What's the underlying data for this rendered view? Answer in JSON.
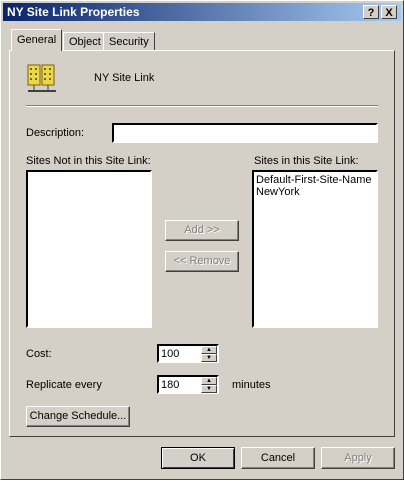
{
  "window": {
    "title": "NY Site Link Properties",
    "help_label": "?",
    "close_label": "X"
  },
  "tabs": [
    {
      "label": "General",
      "active": true
    },
    {
      "label": "Object",
      "active": false
    },
    {
      "label": "Security",
      "active": false
    }
  ],
  "general": {
    "object_name": "NY Site Link",
    "icon": "site-link-icon",
    "description_label": "Description:",
    "description_value": "",
    "sites_not_label": "Sites Not in this Site Link:",
    "sites_in_label": "Sites in this Site Link:",
    "sites_not": [],
    "sites_in": [
      "Default-First-Site-Name",
      "NewYork"
    ],
    "add_label": "Add >>",
    "remove_label": "<< Remove",
    "cost_label": "Cost:",
    "cost_value": "100",
    "replicate_label": "Replicate every",
    "replicate_value": "180",
    "minutes_label": "minutes",
    "change_schedule_label": "Change Schedule..."
  },
  "footer": {
    "ok_label": "OK",
    "cancel_label": "Cancel",
    "apply_label": "Apply"
  }
}
